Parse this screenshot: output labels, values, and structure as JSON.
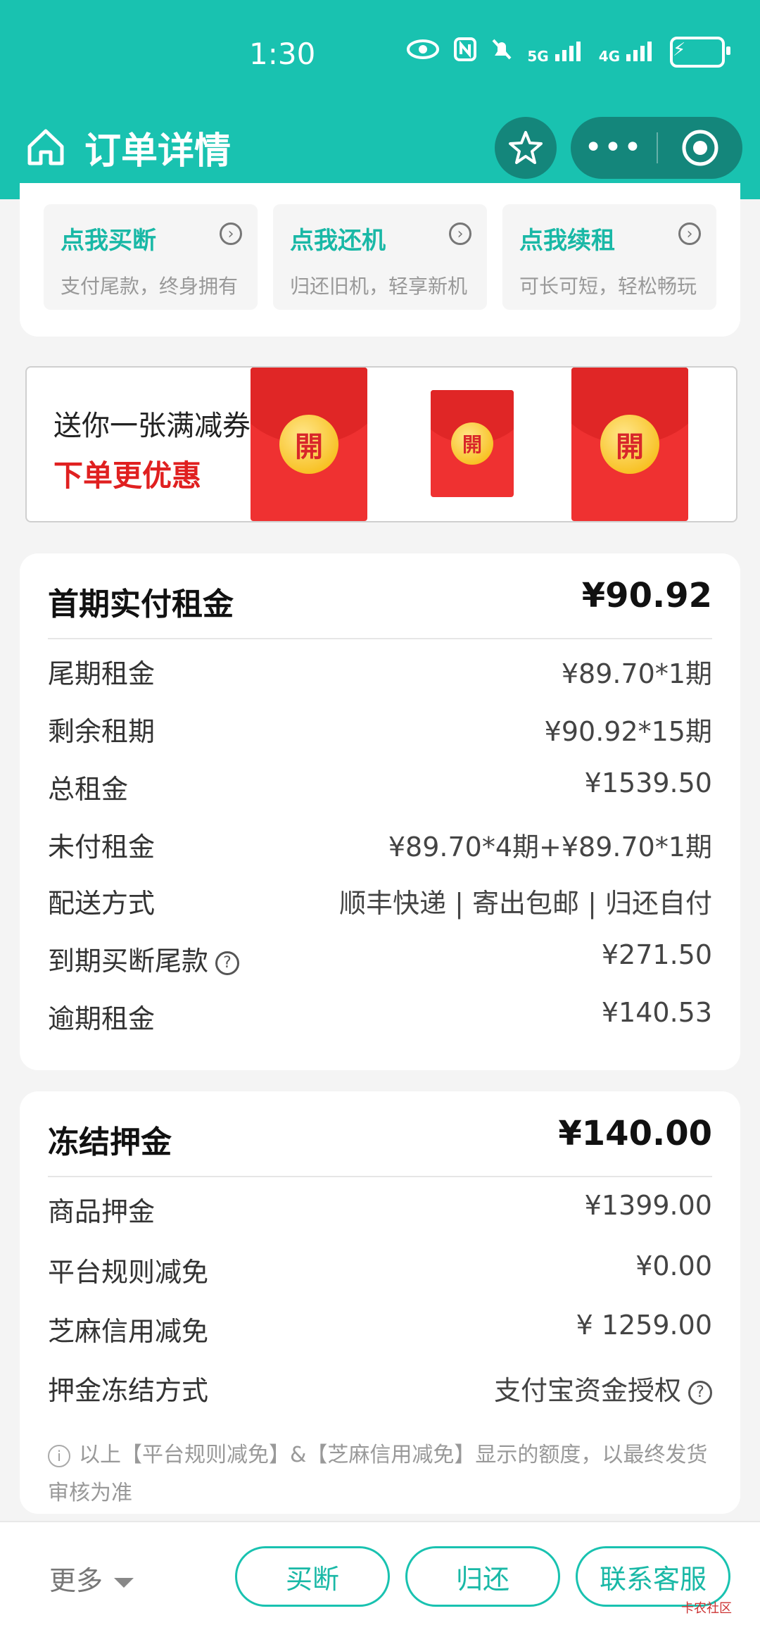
{
  "status": {
    "time": "1:30",
    "net1": "5G",
    "net2": "4G"
  },
  "nav": {
    "title": "订单详情"
  },
  "actions": [
    {
      "title": "点我买断",
      "sub": "支付尾款，终身拥有"
    },
    {
      "title": "点我还机",
      "sub": "归还旧机，轻享新机"
    },
    {
      "title": "点我续租",
      "sub": "可长可短，轻松畅玩"
    }
  ],
  "banner": {
    "line1": "送你一张满减券",
    "line2": "下单更优惠",
    "seal": "開"
  },
  "rent": {
    "title": "首期实付租金",
    "amount": "¥90.92",
    "rows": [
      {
        "label": "尾期租金",
        "value": "¥89.70*1期"
      },
      {
        "label": "剩余租期",
        "value": "¥90.92*15期"
      },
      {
        "label": "总租金",
        "value": "¥1539.50"
      },
      {
        "label": "未付租金",
        "value": "¥89.70*4期+¥89.70*1期"
      },
      {
        "label": "配送方式",
        "value": "顺丰快递 | 寄出包邮 | 归还自付"
      },
      {
        "label": "到期买断尾款",
        "value": "¥271.50"
      },
      {
        "label": "逾期租金",
        "value": "¥140.53"
      }
    ]
  },
  "deposit": {
    "title": "冻结押金",
    "amount": "¥140.00",
    "rows": [
      {
        "label": "商品押金",
        "value": "¥1399.00"
      },
      {
        "label": "平台规则减免",
        "value": "¥0.00"
      },
      {
        "label": "芝麻信用减免",
        "value": "¥ 1259.00"
      },
      {
        "label": "押金冻结方式",
        "value": "支付宝资金授权"
      }
    ],
    "note": "以上【平台规则减免】&【芝麻信用减免】显示的额度，以最终发货审核为准"
  },
  "bottom": {
    "more": "更多",
    "buttons": [
      "买断",
      "归还",
      "联系客服"
    ],
    "watermark": "卡农社区"
  }
}
